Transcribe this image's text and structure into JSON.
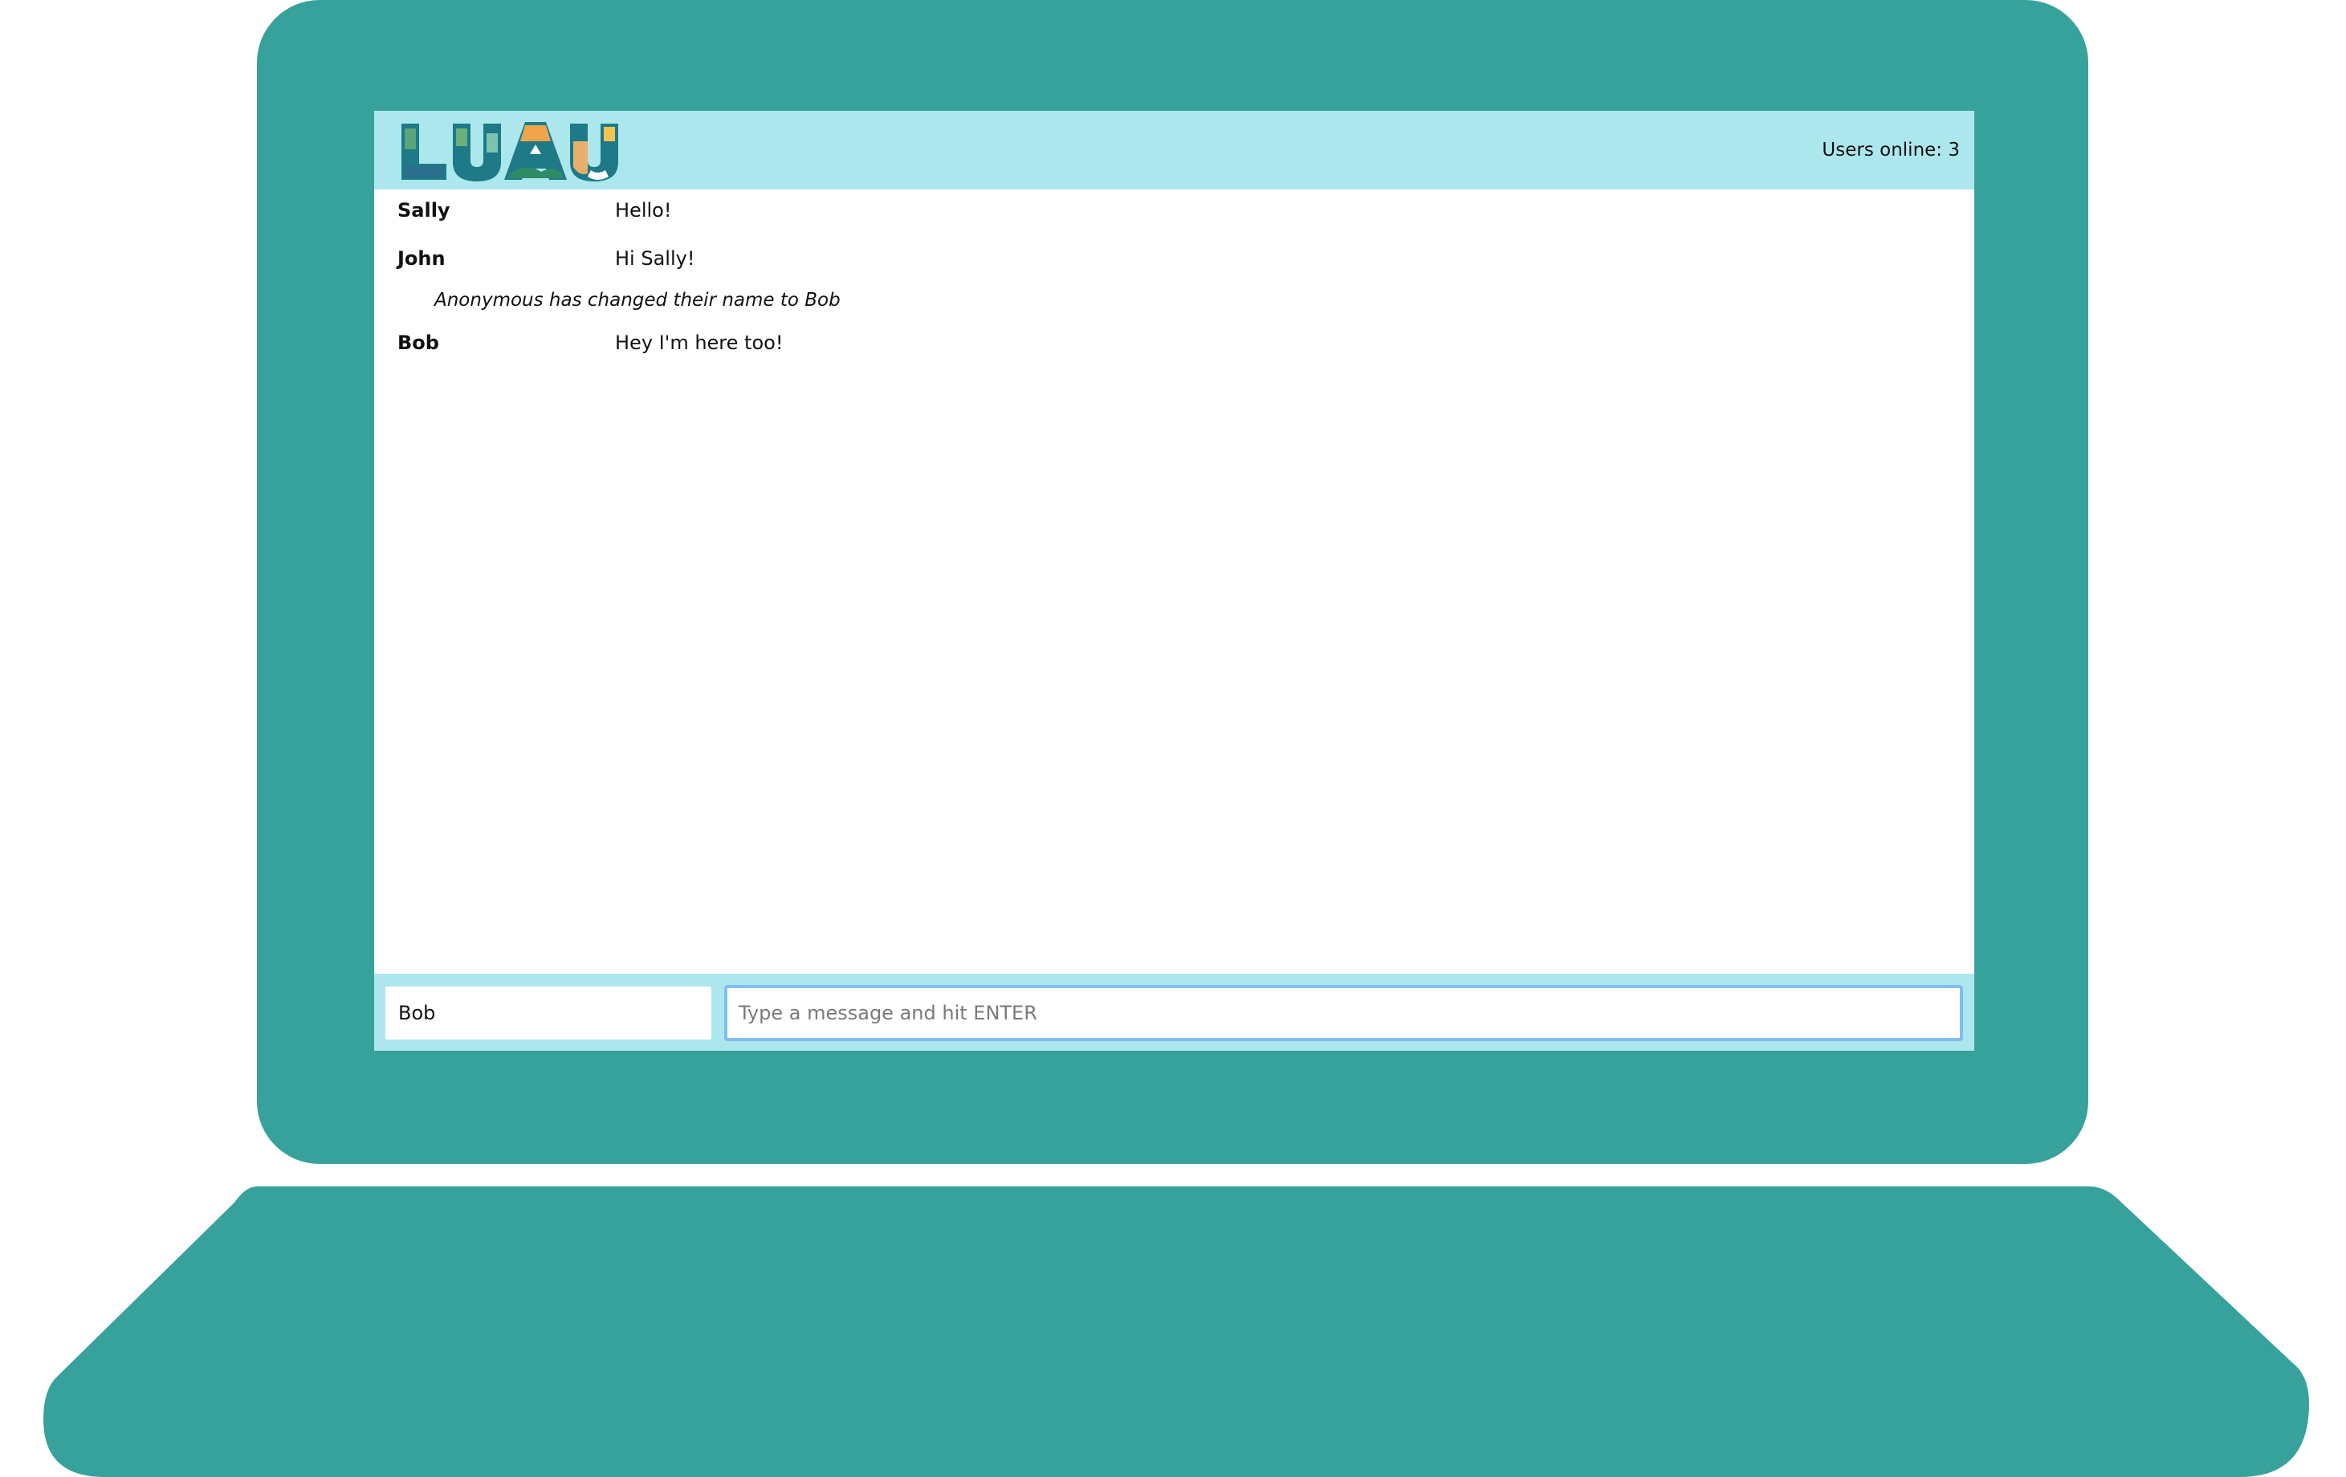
{
  "app": {
    "logo_text": "LUAU",
    "users_online_label": "Users online: 3"
  },
  "messages": [
    {
      "user": "Sally",
      "text": "Hello!"
    },
    {
      "user": "John",
      "text": "Hi Sally!"
    },
    {
      "system": "Anonymous has changed their name to Bob"
    },
    {
      "user": "Bob",
      "text": "Hey I'm here too!"
    }
  ],
  "footer": {
    "name_value": "Bob",
    "message_placeholder": "Type a message and hit ENTER"
  },
  "colors": {
    "laptop": "#37a29b",
    "header_bg": "#ade7ee",
    "input_focus": "#7fbff0"
  }
}
